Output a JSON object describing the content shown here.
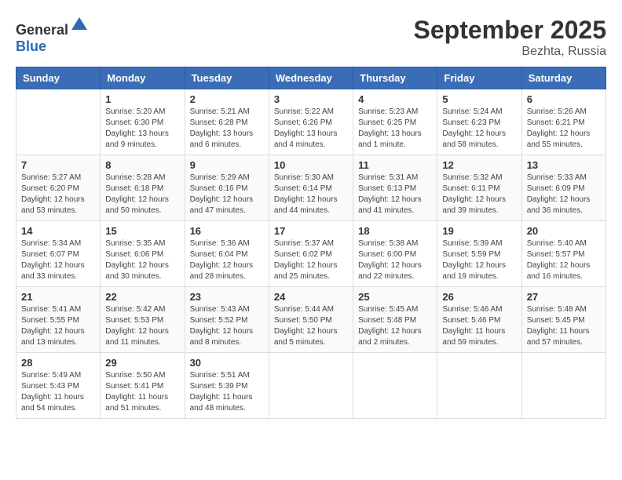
{
  "header": {
    "logo": {
      "general": "General",
      "blue": "Blue"
    },
    "title": "September 2025",
    "subtitle": "Bezhta, Russia"
  },
  "weekdays": [
    "Sunday",
    "Monday",
    "Tuesday",
    "Wednesday",
    "Thursday",
    "Friday",
    "Saturday"
  ],
  "weeks": [
    [
      {
        "day": null
      },
      {
        "day": "1",
        "sunrise": "5:20 AM",
        "sunset": "6:30 PM",
        "daylight": "13 hours and 9 minutes."
      },
      {
        "day": "2",
        "sunrise": "5:21 AM",
        "sunset": "6:28 PM",
        "daylight": "13 hours and 6 minutes."
      },
      {
        "day": "3",
        "sunrise": "5:22 AM",
        "sunset": "6:26 PM",
        "daylight": "13 hours and 4 minutes."
      },
      {
        "day": "4",
        "sunrise": "5:23 AM",
        "sunset": "6:25 PM",
        "daylight": "13 hours and 1 minute."
      },
      {
        "day": "5",
        "sunrise": "5:24 AM",
        "sunset": "6:23 PM",
        "daylight": "12 hours and 58 minutes."
      },
      {
        "day": "6",
        "sunrise": "5:26 AM",
        "sunset": "6:21 PM",
        "daylight": "12 hours and 55 minutes."
      }
    ],
    [
      {
        "day": "7",
        "sunrise": "5:27 AM",
        "sunset": "6:20 PM",
        "daylight": "12 hours and 53 minutes."
      },
      {
        "day": "8",
        "sunrise": "5:28 AM",
        "sunset": "6:18 PM",
        "daylight": "12 hours and 50 minutes."
      },
      {
        "day": "9",
        "sunrise": "5:29 AM",
        "sunset": "6:16 PM",
        "daylight": "12 hours and 47 minutes."
      },
      {
        "day": "10",
        "sunrise": "5:30 AM",
        "sunset": "6:14 PM",
        "daylight": "12 hours and 44 minutes."
      },
      {
        "day": "11",
        "sunrise": "5:31 AM",
        "sunset": "6:13 PM",
        "daylight": "12 hours and 41 minutes."
      },
      {
        "day": "12",
        "sunrise": "5:32 AM",
        "sunset": "6:11 PM",
        "daylight": "12 hours and 39 minutes."
      },
      {
        "day": "13",
        "sunrise": "5:33 AM",
        "sunset": "6:09 PM",
        "daylight": "12 hours and 36 minutes."
      }
    ],
    [
      {
        "day": "14",
        "sunrise": "5:34 AM",
        "sunset": "6:07 PM",
        "daylight": "12 hours and 33 minutes."
      },
      {
        "day": "15",
        "sunrise": "5:35 AM",
        "sunset": "6:06 PM",
        "daylight": "12 hours and 30 minutes."
      },
      {
        "day": "16",
        "sunrise": "5:36 AM",
        "sunset": "6:04 PM",
        "daylight": "12 hours and 28 minutes."
      },
      {
        "day": "17",
        "sunrise": "5:37 AM",
        "sunset": "6:02 PM",
        "daylight": "12 hours and 25 minutes."
      },
      {
        "day": "18",
        "sunrise": "5:38 AM",
        "sunset": "6:00 PM",
        "daylight": "12 hours and 22 minutes."
      },
      {
        "day": "19",
        "sunrise": "5:39 AM",
        "sunset": "5:59 PM",
        "daylight": "12 hours and 19 minutes."
      },
      {
        "day": "20",
        "sunrise": "5:40 AM",
        "sunset": "5:57 PM",
        "daylight": "12 hours and 16 minutes."
      }
    ],
    [
      {
        "day": "21",
        "sunrise": "5:41 AM",
        "sunset": "5:55 PM",
        "daylight": "12 hours and 13 minutes."
      },
      {
        "day": "22",
        "sunrise": "5:42 AM",
        "sunset": "5:53 PM",
        "daylight": "12 hours and 11 minutes."
      },
      {
        "day": "23",
        "sunrise": "5:43 AM",
        "sunset": "5:52 PM",
        "daylight": "12 hours and 8 minutes."
      },
      {
        "day": "24",
        "sunrise": "5:44 AM",
        "sunset": "5:50 PM",
        "daylight": "12 hours and 5 minutes."
      },
      {
        "day": "25",
        "sunrise": "5:45 AM",
        "sunset": "5:48 PM",
        "daylight": "12 hours and 2 minutes."
      },
      {
        "day": "26",
        "sunrise": "5:46 AM",
        "sunset": "5:46 PM",
        "daylight": "11 hours and 59 minutes."
      },
      {
        "day": "27",
        "sunrise": "5:48 AM",
        "sunset": "5:45 PM",
        "daylight": "11 hours and 57 minutes."
      }
    ],
    [
      {
        "day": "28",
        "sunrise": "5:49 AM",
        "sunset": "5:43 PM",
        "daylight": "11 hours and 54 minutes."
      },
      {
        "day": "29",
        "sunrise": "5:50 AM",
        "sunset": "5:41 PM",
        "daylight": "11 hours and 51 minutes."
      },
      {
        "day": "30",
        "sunrise": "5:51 AM",
        "sunset": "5:39 PM",
        "daylight": "11 hours and 48 minutes."
      },
      {
        "day": null
      },
      {
        "day": null
      },
      {
        "day": null
      },
      {
        "day": null
      }
    ]
  ]
}
